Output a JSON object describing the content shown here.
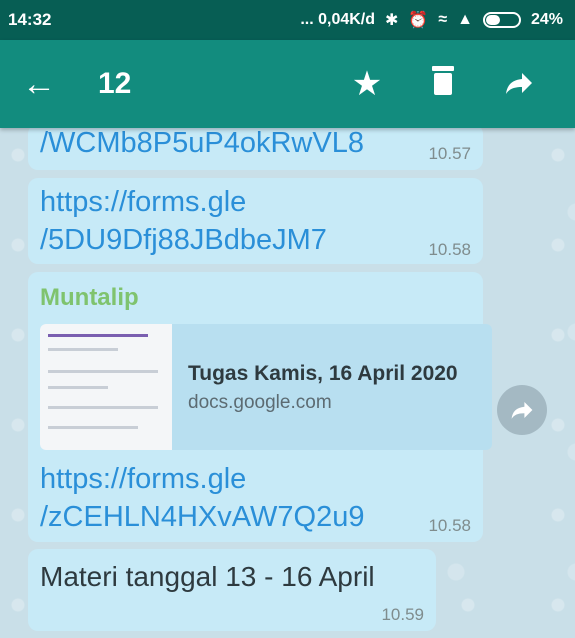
{
  "status_bar": {
    "time": "14:32",
    "network_speed": "... 0,04K/d",
    "battery": "24%"
  },
  "toolbar": {
    "selected_count": "12",
    "icons": [
      "back-arrow-icon",
      "star-icon",
      "trash-icon",
      "forward-icon"
    ]
  },
  "messages": [
    {
      "text_line2": "/WCMb8P5uP4okRwVL8",
      "time": "10.57"
    },
    {
      "text_line1": "https://forms.gle",
      "text_line2": "/5DU9Dfj88JBdbeJM7",
      "time": "10.58"
    },
    {
      "sender": "Muntalip",
      "preview_title": "Tugas Kamis, 16 April 2020",
      "preview_domain": "docs.google.com",
      "text_line1": "https://forms.gle",
      "text_line2": "/zCEHLN4HXvAW7Q2u9",
      "time": "10.58"
    },
    {
      "text": "Materi tanggal 13 - 16 April",
      "time": "10.59"
    }
  ],
  "colors": {
    "status_bar": "#075e54",
    "toolbar": "#128c7e",
    "bubble": "#c7eaf7",
    "link": "#2a8fd8",
    "sender": "#7fc36e"
  }
}
